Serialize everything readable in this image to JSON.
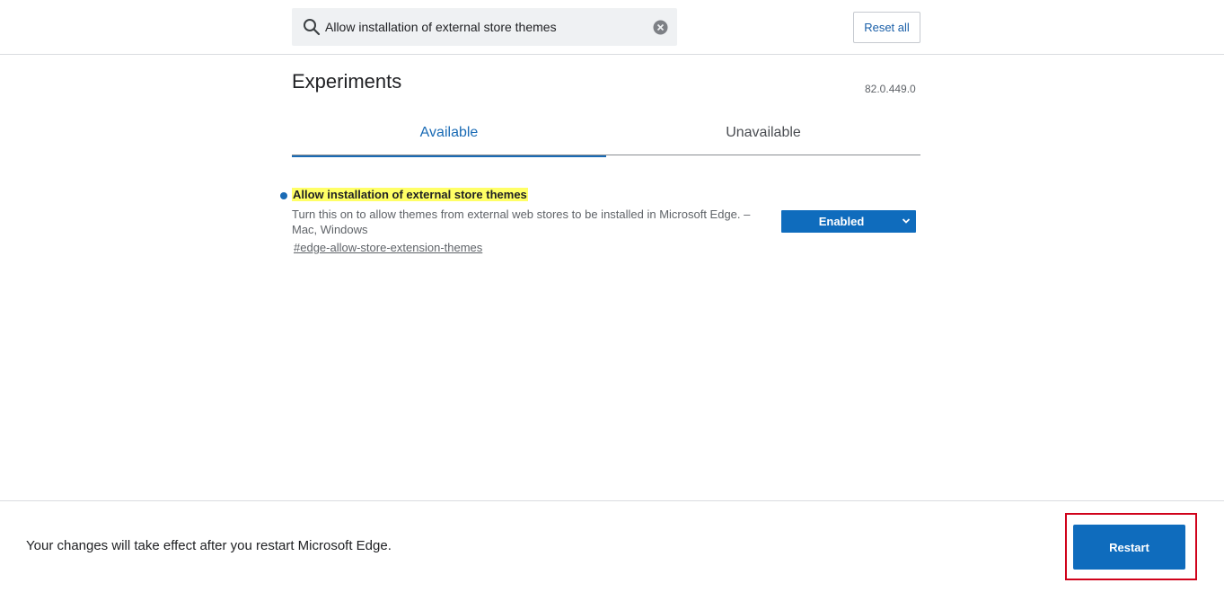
{
  "header": {
    "search_value": "Allow installation of external store themes",
    "search_icon": "search-icon",
    "clear_icon": "clear-icon",
    "reset_label": "Reset all"
  },
  "main": {
    "title": "Experiments",
    "version": "82.0.449.0",
    "tabs": [
      {
        "label": "Available",
        "active": true
      },
      {
        "label": "Unavailable",
        "active": false
      }
    ],
    "experiments": [
      {
        "title": "Allow installation of external store themes",
        "description": "Turn this on to allow themes from external web stores to be installed in Microsoft Edge. – Mac, Windows",
        "link": "#edge-allow-store-extension-themes",
        "selected_value": "Enabled"
      }
    ]
  },
  "footer": {
    "message": "Your changes will take effect after you restart Microsoft Edge.",
    "restart_label": "Restart"
  },
  "colors": {
    "accent": "#0f6cbd",
    "tab_active": "#1a6bb5",
    "highlight": "#ffff66",
    "annotation_box": "#d0021b"
  }
}
